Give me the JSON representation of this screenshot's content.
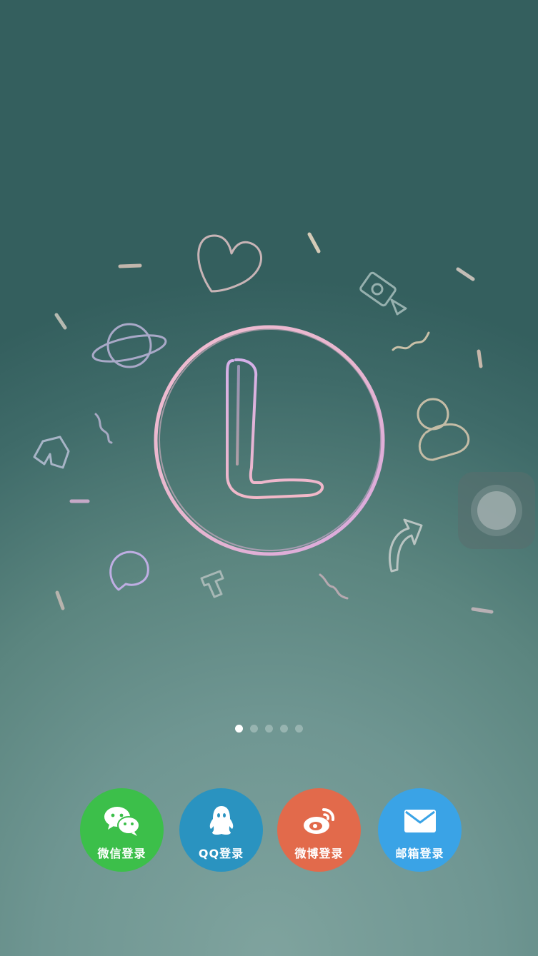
{
  "logo": {
    "letter": "L",
    "ring_color": "#e6b3d6"
  },
  "pager": {
    "count": 5,
    "active_index": 0
  },
  "login_buttons": [
    {
      "label": "微信登录",
      "icon": "wechat-icon",
      "color": "#3cbf4a"
    },
    {
      "label": "QQ登录",
      "icon": "qq-icon",
      "color": "#2a93c0"
    },
    {
      "label": "微博登录",
      "icon": "weibo-icon",
      "color": "#e26a4b"
    },
    {
      "label": "邮箱登录",
      "icon": "mail-icon",
      "color": "#3aa3e6"
    }
  ],
  "assistive_touch": {
    "icon": "assistive-touch-icon"
  }
}
